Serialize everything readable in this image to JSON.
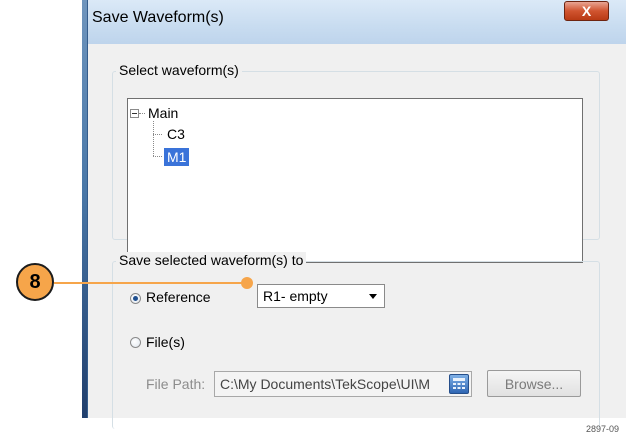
{
  "window": {
    "title": "Save Waveform(s)",
    "close_label": "X"
  },
  "select_group": {
    "legend": "Select waveform(s)",
    "tree": {
      "root_label": "Main",
      "children": [
        "C3",
        "M1"
      ],
      "selected": "M1"
    }
  },
  "save_group": {
    "legend": "Save selected waveform(s) to",
    "reference_label": "Reference",
    "reference_checked": true,
    "reference_select_value": "R1- empty",
    "files_label": "File(s)",
    "files_checked": false,
    "file_path_label": "File Path:",
    "file_path_value": "C:\\My Documents\\TekScope\\UI\\M",
    "browse_label": "Browse..."
  },
  "annotation": {
    "callout_number": "8",
    "figure_id": "2897-09"
  },
  "colors": {
    "selection": "#3a73d9",
    "callout": "#f6a54a",
    "close_button": "#d0542f"
  }
}
